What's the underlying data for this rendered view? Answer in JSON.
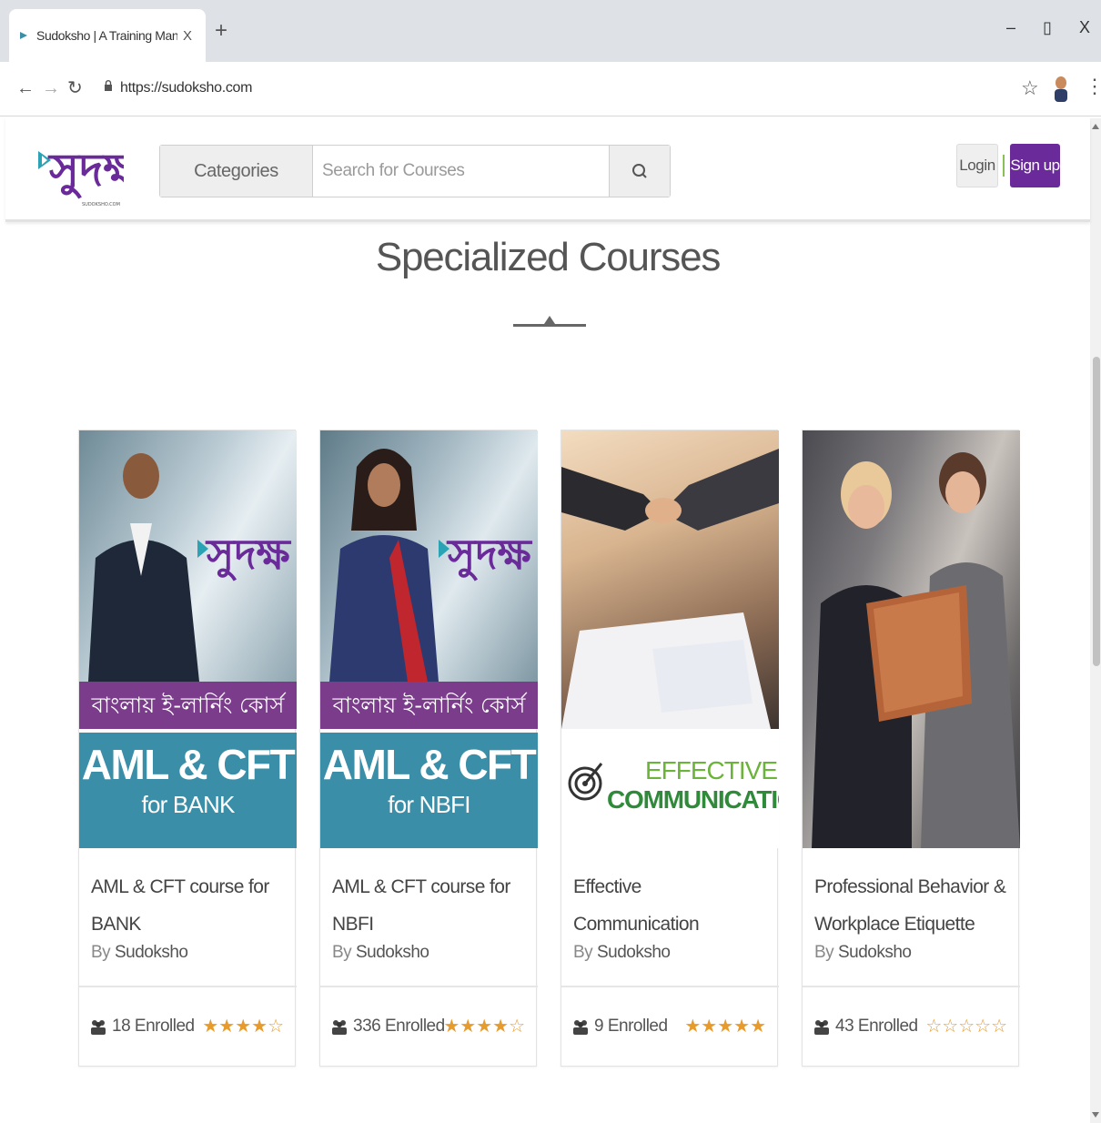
{
  "browser": {
    "tab_title": "Sudoksho | A Training Managem",
    "tab_close": "X",
    "new_tab": "+",
    "url": "https://sudoksho.com",
    "window_controls": {
      "minimize": "–",
      "restore": "▯",
      "close": "X"
    }
  },
  "header": {
    "logo_text": "সুদক্ষ",
    "logo_subtext": "SUDOKSHO.COM",
    "categories_label": "Categories",
    "search_placeholder": "Search for Courses",
    "login_label": "Login",
    "signup_label": "Sign up",
    "signup_color": "#6a2a9a"
  },
  "section": {
    "title": "Specialized Courses"
  },
  "courses": [
    {
      "title_lines": [
        "AML & CFT course for BANK"
      ],
      "by": "By",
      "author": "Sudoksho",
      "enrolled": "18 Enrolled",
      "rating": 4,
      "thumb": {
        "banner": "বাংলায় ই-লার্নিং কোর্স",
        "main": "AML & CFT",
        "sub": "for BANK",
        "logo": "সুদক্ষ"
      }
    },
    {
      "title_lines": [
        "AML & CFT course for NBFI"
      ],
      "by": "By",
      "author": "Sudoksho",
      "enrolled": "336 Enrolled",
      "rating": 4,
      "thumb": {
        "banner": "বাংলায় ই-লার্নিং কোর্স",
        "main": "AML & CFT",
        "sub": "for NBFI",
        "logo": "সুদক্ষ"
      }
    },
    {
      "title_lines": [
        "Effective Communication"
      ],
      "by": "By",
      "author": "Sudoksho",
      "enrolled": "9 Enrolled",
      "rating": 5,
      "thumb": {
        "small": "EFFECTIVE",
        "big": "COMMUNICATION"
      }
    },
    {
      "title_lines": [
        "Professional Behavior &",
        "Workplace Etiquette"
      ],
      "by": "By",
      "author": "Sudoksho",
      "enrolled": "43 Enrolled",
      "rating": 0
    }
  ]
}
